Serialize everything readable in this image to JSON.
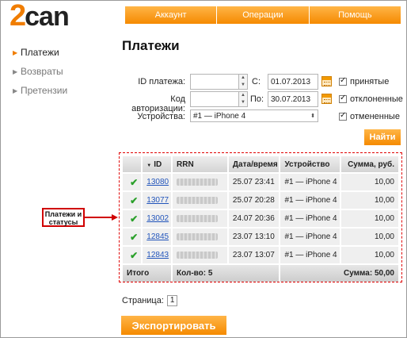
{
  "logo": {
    "two": "2",
    "word": "can"
  },
  "topnav": [
    "Аккаунт",
    "Операции",
    "Помощь"
  ],
  "sidebar": {
    "items": [
      {
        "label": "Платежи",
        "active": true
      },
      {
        "label": "Возвраты",
        "active": false
      },
      {
        "label": "Претензии",
        "active": false
      }
    ]
  },
  "page_title": "Платежи",
  "filters": {
    "payment_id_label": "ID платежа:",
    "auth_code_label": "Код авторизации:",
    "device_label": "Устройства:",
    "from_label": "С:",
    "to_label": "По:",
    "from_date": "01.07.2013",
    "to_date": "30.07.2013",
    "device_value": "#1 — iPhone 4",
    "statuses": [
      "принятые",
      "отклоненные",
      "отмененные"
    ],
    "find_button": "Найти"
  },
  "table": {
    "headers": [
      "",
      "ID",
      "RRN",
      "Дата/время",
      "Устройство",
      "Сумма, руб."
    ],
    "rows": [
      {
        "id": "13080",
        "datetime": "25.07 23:41",
        "device": "#1 — iPhone 4",
        "amount": "10,00"
      },
      {
        "id": "13077",
        "datetime": "25.07 20:28",
        "device": "#1 — iPhone 4",
        "amount": "10,00"
      },
      {
        "id": "13002",
        "datetime": "24.07 20:36",
        "device": "#1 — iPhone 4",
        "amount": "10,00"
      },
      {
        "id": "12845",
        "datetime": "23.07 13:10",
        "device": "#1 — iPhone 4",
        "amount": "10,00"
      },
      {
        "id": "12843",
        "datetime": "23.07 13:07",
        "device": "#1 — iPhone 4",
        "amount": "10,00"
      }
    ],
    "footer": {
      "total": "Итого",
      "count": "Кол-во: 5",
      "sum": "Сумма: 50,00"
    }
  },
  "annotation": "Платежи и статусы",
  "pager": {
    "label": "Страница:",
    "page": "1"
  },
  "export_button": "Экспортировать",
  "colors": {
    "accent": "#f58a00",
    "link": "#2255bb",
    "ok": "#2aa02a",
    "annotation": "#d00000"
  }
}
